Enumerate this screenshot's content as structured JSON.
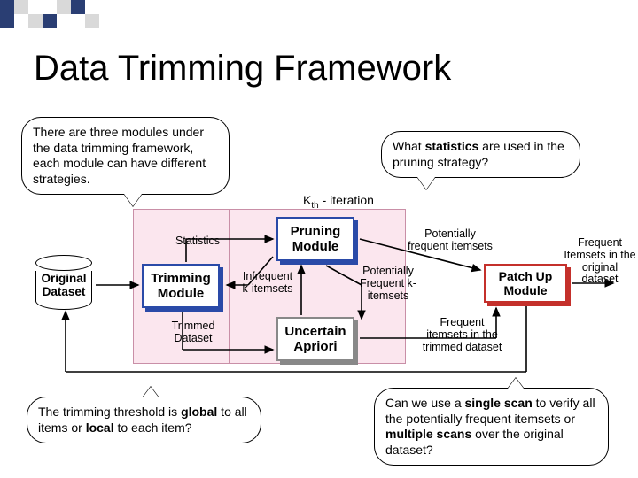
{
  "title": "Data Trimming Framework",
  "bubbles": {
    "top_left": "There are three modules under the data trimming framework, each module can have different strategies.",
    "top_right_prefix": "What ",
    "top_right_bold": "statistics",
    "top_right_suffix": " are used in the pruning strategy?",
    "bottom_left_prefix": "The trimming threshold is ",
    "bottom_left_bold1": "global",
    "bottom_left_mid": " to all items or ",
    "bottom_left_bold2": "local",
    "bottom_left_suffix": " to each item?",
    "bottom_right_prefix": "Can we use a ",
    "bottom_right_bold1": "single scan",
    "bottom_right_mid": " to verify all the potentially frequent itemsets or ",
    "bottom_right_bold2": "multiple scans",
    "bottom_right_suffix": " over the original dataset?"
  },
  "iteration_label_prefix": "K",
  "iteration_label_sub": "th",
  "iteration_label_suffix": " - iteration",
  "labels": {
    "statistics": "Statistics",
    "potentially_frequent_itemsets": "Potentially frequent itemsets",
    "frequent_in_original": "Frequent Itemsets in the original dataset",
    "original_dataset": "Original Dataset",
    "infrequent_k_itemsets": "Infrequent k-itemsets",
    "potentially_frequent_k_itemsets": "Potentially Frequent k-itemsets",
    "trimmed_dataset": "Trimmed Dataset",
    "frequent_in_trimmed": "Frequent itemsets in the trimmed dataset"
  },
  "modules": {
    "trimming": "Trimming Module",
    "pruning": "Pruning Module",
    "uncertain_apriori": "Uncertain Apriori",
    "patchup": "Patch Up Module"
  }
}
